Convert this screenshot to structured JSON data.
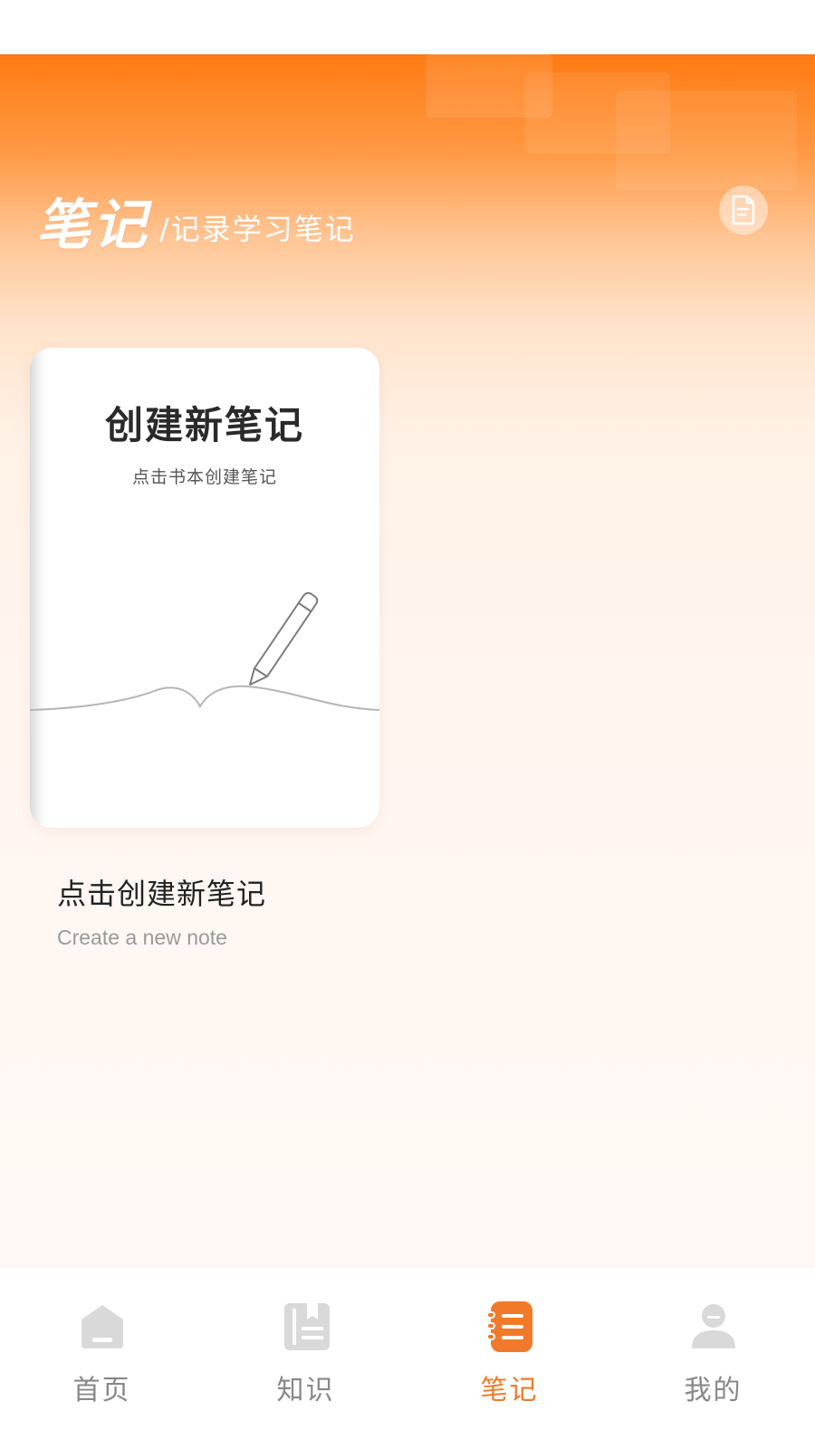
{
  "header": {
    "title": "笔记",
    "subtitle": "/记录学习笔记"
  },
  "note_card": {
    "title": "创建新笔记",
    "subtitle": "点击书本创建笔记"
  },
  "create": {
    "label": "点击创建新笔记",
    "label_en": "Create a new note"
  },
  "tabbar": {
    "tabs": [
      {
        "label": "首页",
        "icon": "home-icon",
        "active": false
      },
      {
        "label": "知识",
        "icon": "knowledge-book-icon",
        "active": false
      },
      {
        "label": "笔记",
        "icon": "notes-icon",
        "active": true
      },
      {
        "label": "我的",
        "icon": "profile-icon",
        "active": false
      }
    ]
  },
  "colors": {
    "accent": "#f07a2a",
    "header_orange": "#ff7a12",
    "inactive_tab": "#888888"
  }
}
